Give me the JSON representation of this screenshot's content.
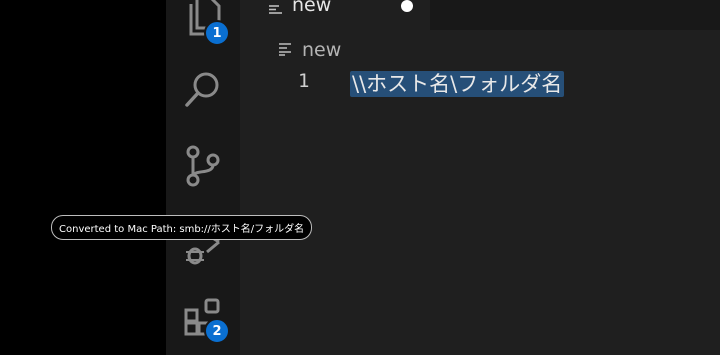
{
  "activity_bar": {
    "explorer": {
      "icon": "files-icon",
      "badge": "1"
    },
    "search": {
      "icon": "search-icon"
    },
    "source_control": {
      "icon": "source-control-icon"
    },
    "run_debug": {
      "icon": "debug-icon"
    },
    "extensions": {
      "icon": "extensions-icon",
      "badge": "2"
    }
  },
  "tab": {
    "title": "new",
    "icon": "lines-icon",
    "modified_dot": true
  },
  "breadcrumb": {
    "label": "new",
    "icon": "lines-icon"
  },
  "editor": {
    "lines": [
      {
        "number": "1",
        "text": "\\\\ホスト名\\フォルダ名"
      }
    ],
    "selection_color": "#264f78"
  },
  "tooltip": {
    "text": "Converted to Mac Path: smb://ホスト名/フォルダ名"
  },
  "colors": {
    "badge": "#0a6fd1",
    "activity_bar": "#181818",
    "editor_bg": "#1f1f1f"
  }
}
